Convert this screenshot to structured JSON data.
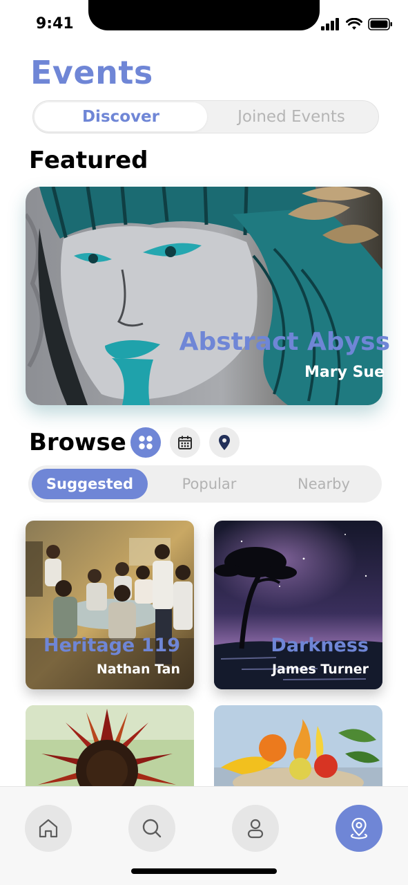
{
  "status_bar": {
    "time": "9:41"
  },
  "header": {
    "title": "Events"
  },
  "segmented": {
    "discover": "Discover",
    "joined": "Joined Events",
    "selected": "Discover"
  },
  "featured": {
    "heading": "Featured",
    "card": {
      "title": "Abstract Abyss",
      "author": "Mary Sue"
    }
  },
  "browse": {
    "heading": "Browse",
    "view_icons": [
      "grid-icon",
      "calendar-icon",
      "location-pin-icon"
    ],
    "tabs": [
      "Suggested",
      "Popular",
      "Nearby"
    ],
    "selected_tab": "Suggested"
  },
  "events": [
    {
      "title": "Heritage 119",
      "author": "Nathan Tan"
    },
    {
      "title": "Darkness",
      "author": "James Turner"
    },
    {
      "title": "",
      "author": ""
    },
    {
      "title": "",
      "author": ""
    }
  ],
  "nav": {
    "items": [
      "home-icon",
      "search-icon",
      "profile-icon",
      "map-pin-icon"
    ],
    "active": "map-pin-icon"
  },
  "colors": {
    "accent": "#6f86d6",
    "muted": "#b2b2b2",
    "background": "#ffffff"
  }
}
